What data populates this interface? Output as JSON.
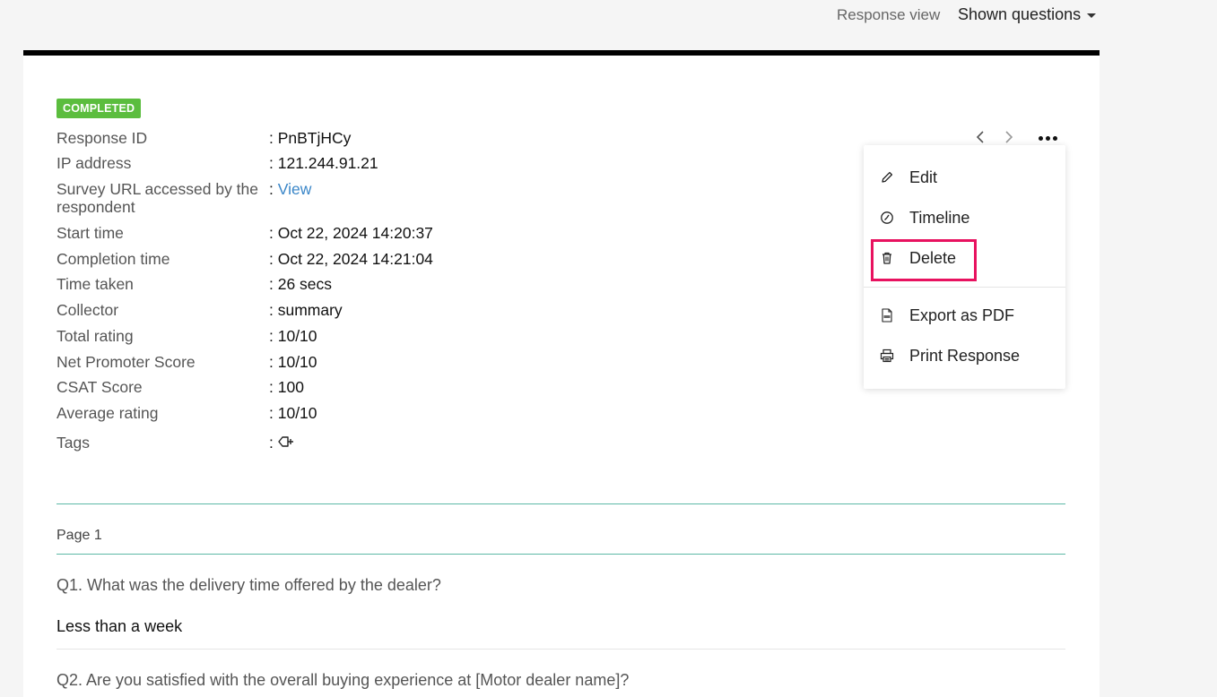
{
  "topbar": {
    "response_view_label": "Response view",
    "shown_questions_label": "Shown questions"
  },
  "status": {
    "label": "COMPLETED",
    "color": "#5bbd3e"
  },
  "meta": {
    "response_id": {
      "key": "Response ID",
      "value": ": PnBTjHCy"
    },
    "ip_address": {
      "key": "IP address",
      "value": ": 121.244.91.21"
    },
    "survey_url": {
      "key": "Survey URL accessed by the respondent",
      "prefix": ": ",
      "link": "View"
    },
    "start_time": {
      "key": "Start time",
      "value": ": Oct 22, 2024 14:20:37"
    },
    "completion_time": {
      "key": "Completion time",
      "value": ": Oct 22, 2024 14:21:04"
    },
    "time_taken": {
      "key": "Time taken",
      "value": ": 26 secs"
    },
    "collector": {
      "key": "Collector",
      "value": ": summary"
    },
    "total_rating": {
      "key": "Total rating",
      "value": ": 10/10"
    },
    "nps": {
      "key": "Net Promoter Score",
      "value": ": 10/10"
    },
    "csat": {
      "key": "CSAT Score",
      "value": ": 100"
    },
    "average_rating": {
      "key": "Average rating",
      "value": ": 10/10"
    },
    "tags": {
      "key": "Tags",
      "prefix": ":",
      "icon": "add-tag-icon"
    }
  },
  "menu": {
    "edit": {
      "label": "Edit",
      "icon": "pencil-icon"
    },
    "timeline": {
      "label": "Timeline",
      "icon": "clock-icon"
    },
    "delete": {
      "label": "Delete",
      "icon": "trash-icon"
    },
    "export_pdf": {
      "label": "Export as PDF",
      "icon": "pdf-file-icon"
    },
    "print": {
      "label": "Print Response",
      "icon": "printer-icon"
    },
    "highlight_color": "#e8125f"
  },
  "page": {
    "label": "Page 1",
    "questions": [
      {
        "text": "Q1. What was the delivery time offered by the dealer?",
        "answer": "Less than a week"
      },
      {
        "text": "Q2. Are you satisfied with the overall buying experience at [Motor dealer name]?"
      }
    ]
  },
  "colors": {
    "accent_link": "#3a86c8",
    "divider_teal": "#5cb8a6"
  }
}
